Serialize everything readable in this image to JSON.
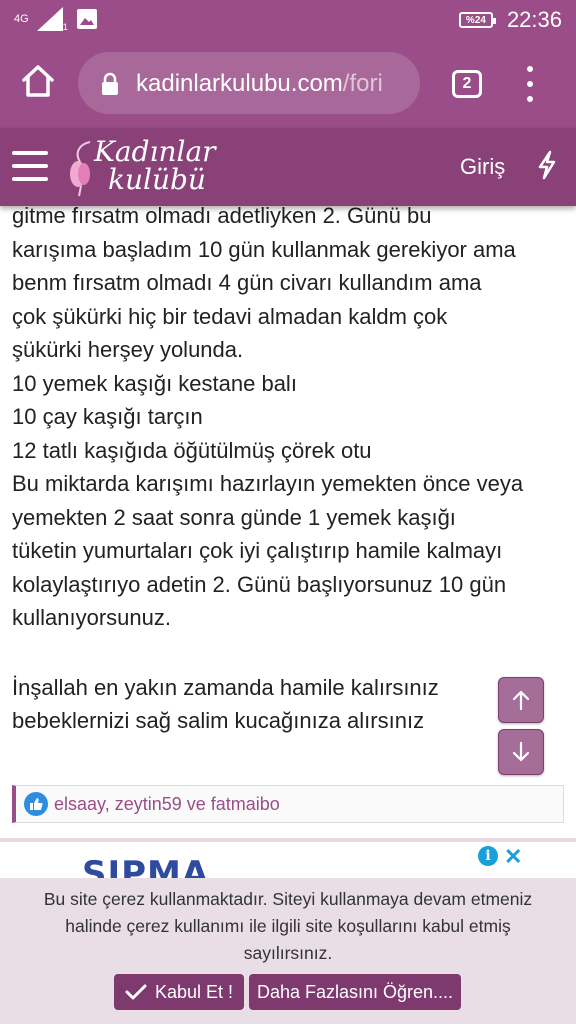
{
  "status_bar": {
    "network": "4G",
    "network_sub": "1",
    "battery": "%24",
    "time": "22:36"
  },
  "browser": {
    "url_main": "kadinlarkulubu.com",
    "url_rest": "/fori",
    "tab_count": "2"
  },
  "site_header": {
    "logo_line1": "Kadınlar",
    "logo_line2": "kulübü",
    "login": "Giriş"
  },
  "post": {
    "lines": [
      "gitme fırsatm olmadı adetliyken 2. Günü bu",
      "karışıma başladım 10 gün kullanmak gerekiyor ama",
      "benm fırsatm olmadı 4 gün civarı kullandım ama",
      "çok şükürki hiç bir tedavi almadan kaldm çok",
      "şükürki herşey yolunda.",
      "10 yemek kaşığı kestane balı",
      "10 çay kaşığı tarçın",
      "12 tatlı kaşığıda öğütülmüş çörek otu",
      "Bu miktarda karışımı hazırlayın yemekten önce veya",
      "yemekten 2 saat sonra günde 1 yemek kaşığı",
      "tüketin yumurtaları çok iyi çalıştırıp hamile kalmayı",
      "kolaylaştırıyo adetin 2. Günü başlıyorsunuz 10 gün",
      "kullanıyorsunuz."
    ],
    "closing_lines": [
      "İnşallah en yakın zamanda hamile kalırsınız",
      "bebeklernizi sağ salim kucağınıza alırsınız"
    ]
  },
  "reactions": {
    "text": "elsaay, zeytin59 ve fatmaibo"
  },
  "ad": {
    "brand": "SIPMA"
  },
  "cookie": {
    "lines": [
      "Bu site çerez kullanmaktadır. Siteyi kullanmaya devam etmeniz",
      "halinde çerez kullanımı ile ilgili site koşullarını kabul etmiş",
      "sayılırsınız."
    ],
    "accept_label": "Kabul Et !",
    "more_label": "Daha Fazlasını Öğren...."
  },
  "colors": {
    "brand_purple": "#9a4d88",
    "header_purple": "#894178",
    "button_purple": "#7e3a6e"
  }
}
